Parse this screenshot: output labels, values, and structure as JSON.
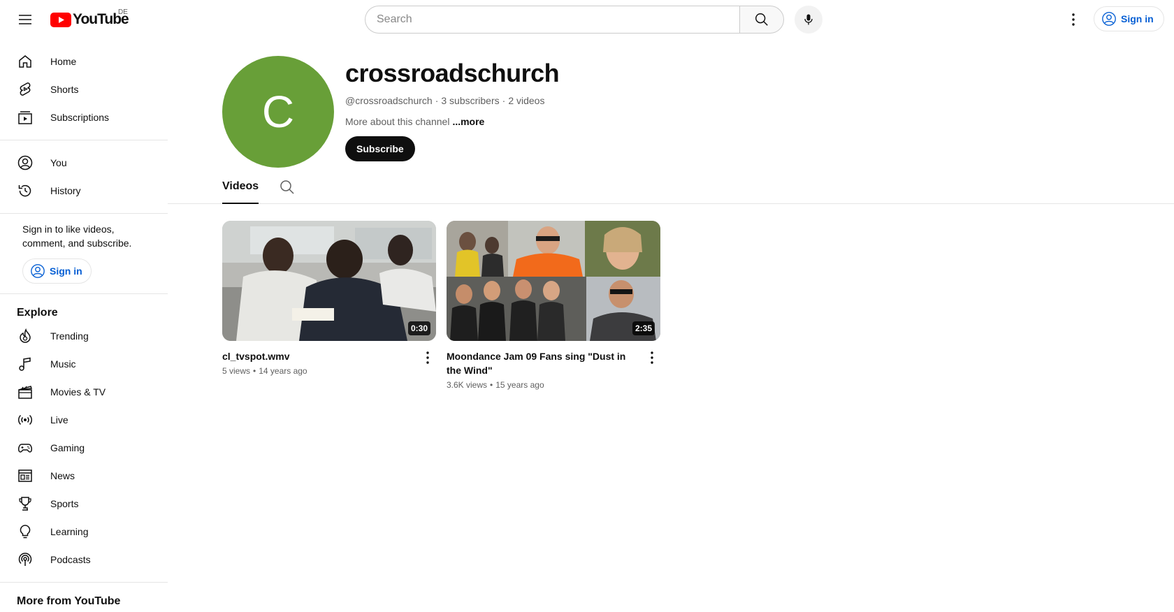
{
  "header": {
    "logo_text": "YouTube",
    "country_code": "DE",
    "search_placeholder": "Search",
    "sign_in_label": "Sign in"
  },
  "sidebar": {
    "main_items": [
      {
        "label": "Home",
        "icon": "home-icon"
      },
      {
        "label": "Shorts",
        "icon": "shorts-icon"
      },
      {
        "label": "Subscriptions",
        "icon": "subscriptions-icon"
      }
    ],
    "you_items": [
      {
        "label": "You",
        "icon": "you-icon"
      },
      {
        "label": "History",
        "icon": "history-icon"
      }
    ],
    "signin_prompt": "Sign in to like videos, comment, and subscribe.",
    "signin_button": "Sign in",
    "explore_heading": "Explore",
    "explore_items": [
      {
        "label": "Trending",
        "icon": "trending-icon"
      },
      {
        "label": "Music",
        "icon": "music-icon"
      },
      {
        "label": "Movies & TV",
        "icon": "movies-icon"
      },
      {
        "label": "Live",
        "icon": "live-icon"
      },
      {
        "label": "Gaming",
        "icon": "gaming-icon"
      },
      {
        "label": "News",
        "icon": "news-icon"
      },
      {
        "label": "Sports",
        "icon": "sports-icon"
      },
      {
        "label": "Learning",
        "icon": "learning-icon"
      },
      {
        "label": "Podcasts",
        "icon": "podcasts-icon"
      }
    ],
    "more_heading": "More from YouTube"
  },
  "channel": {
    "avatar_letter": "C",
    "avatar_color": "#689f38",
    "name": "crossroadschurch",
    "handle": "@crossroadschurch",
    "subscribers": "3 subscribers",
    "video_count": "2 videos",
    "separator": "·",
    "about_text": "More about this channel",
    "about_more": "...more",
    "subscribe_label": "Subscribe"
  },
  "tabs": {
    "videos_label": "Videos"
  },
  "videos": [
    {
      "title": "cl_tvspot.wmv",
      "views": "5 views",
      "age": "14 years ago",
      "duration": "0:30"
    },
    {
      "title": "Moondance Jam 09 Fans sing \"Dust in the Wind\"",
      "views": "3.6K views",
      "age": "15 years ago",
      "duration": "2:35"
    }
  ],
  "meta_dot": "•",
  "colors": {
    "brand_red": "#ff0000",
    "link_blue": "#065fd4",
    "text_primary": "#0f0f0f",
    "text_secondary": "#606060"
  }
}
